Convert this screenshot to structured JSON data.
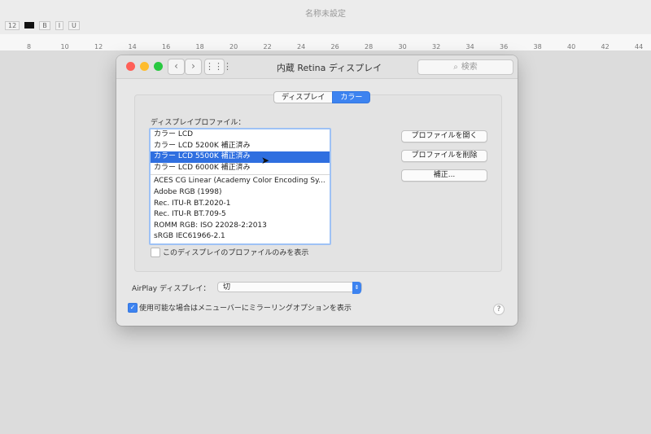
{
  "background_doc": {
    "title": "名称未設定",
    "ruler_numbers": [
      "8",
      "10",
      "12",
      "14",
      "16",
      "18",
      "20",
      "22",
      "24",
      "26",
      "28",
      "30",
      "32",
      "34",
      "36",
      "38",
      "40",
      "42",
      "44"
    ],
    "toolbar": {
      "font_size": "12",
      "bold": "B",
      "italic": "I",
      "underline": "U"
    }
  },
  "window": {
    "title": "内蔵 Retina ディスプレイ",
    "search_placeholder": "検索",
    "tabs": [
      {
        "label": "ディスプレイ",
        "active": false
      },
      {
        "label": "カラー",
        "active": true
      }
    ]
  },
  "color_tab": {
    "profiles_label": "ディスプレイプロファイル：",
    "profiles_group1": [
      "カラー LCD",
      "カラー LCD 5200K 補正済み",
      "カラー LCD 5500K 補正済み",
      "カラー LCD 6000K 補正済み"
    ],
    "selected_index": 2,
    "profiles_group2": [
      "ACES CG Linear (Academy Color Encoding Sy...",
      "Adobe RGB (1998)",
      "Rec. ITU-R BT.2020-1",
      "Rec. ITU-R BT.709-5",
      "ROMM RGB: ISO 22028-2:2013",
      "sRGB IEC61966-2.1"
    ],
    "open_profile_button": "プロファイルを開く",
    "delete_profile_button": "プロファイルを削除",
    "calibrate_button": "補正...",
    "only_this_display_label": "このディスプレイのプロファイルのみを表示",
    "only_this_display_checked": false
  },
  "footer": {
    "airplay_label": "AirPlay ディスプレイ：",
    "airplay_value": "切",
    "mirroring_label": "使用可能な場合はメニューバーにミラーリングオプションを表示",
    "mirroring_checked": true,
    "help": "?"
  },
  "colors": {
    "accent": "#3d83f0",
    "selection": "#2f6fe0"
  }
}
